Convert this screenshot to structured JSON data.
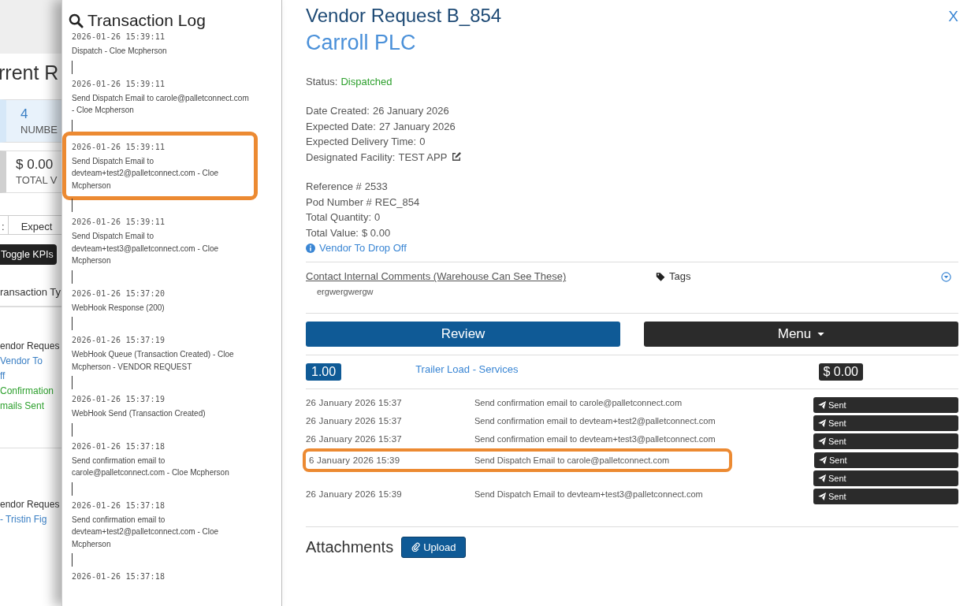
{
  "background_page": {
    "heading": "rrent R",
    "kpis": [
      {
        "value": "4",
        "label": "NUMBE"
      },
      {
        "value": "$ 0.00",
        "label": "TOTAL V"
      }
    ],
    "tab_labels": [
      ":",
      "Expect"
    ],
    "toggle_button": "Toggle KPIs",
    "column_header": "ransaction Ty",
    "rows": [
      {
        "lines": [
          {
            "text": "endor Reques",
            "kind": "plain"
          },
          {
            "text": "Vendor To",
            "kind": "link"
          },
          {
            "text": "ff",
            "kind": "link"
          },
          {
            "text": "Confirmation",
            "kind": "success"
          },
          {
            "text": "mails Sent",
            "kind": "success"
          }
        ]
      },
      {
        "lines": [
          {
            "text": "endor Reques",
            "kind": "plain"
          },
          {
            "text": "- Tristin Fig",
            "kind": "link"
          }
        ]
      }
    ]
  },
  "transaction_log": {
    "title": "Transaction Log",
    "entries": [
      {
        "time": "2026-01-26 15:39:11",
        "text": "Dispatch - Cloe Mcpherson",
        "highlighted": false
      },
      {
        "time": "2026-01-26 15:39:11",
        "text": "Send Dispatch Email to carole@palletconnect.com - Cloe Mcpherson",
        "highlighted": false
      },
      {
        "time": "2026-01-26 15:39:11",
        "text": "Send Dispatch Email to devteam+test2@palletconnect.com - Cloe Mcpherson",
        "highlighted": true
      },
      {
        "time": "2026-01-26 15:39:11",
        "text": "Send Dispatch Email to devteam+test3@palletconnect.com - Cloe Mcpherson",
        "highlighted": false
      },
      {
        "time": "2026-01-26 15:37:20",
        "text": "WebHook Response (200)",
        "highlighted": false
      },
      {
        "time": "2026-01-26 15:37:19",
        "text": "WebHook Queue (Transaction Created) - Cloe Mcpherson - VENDOR REQUEST",
        "highlighted": false
      },
      {
        "time": "2026-01-26 15:37:19",
        "text": "WebHook Send (Transaction Created)",
        "highlighted": false
      },
      {
        "time": "2026-01-26 15:37:18",
        "text": "Send confirmation email to carole@palletconnect.com - Cloe Mcpherson",
        "highlighted": false
      },
      {
        "time": "2026-01-26 15:37:18",
        "text": "Send confirmation email to devteam+test2@palletconnect.com - Cloe Mcpherson",
        "highlighted": false
      },
      {
        "time": "2026-01-26 15:37:18",
        "highlighted": false
      }
    ]
  },
  "detail": {
    "title": "Vendor Request B_854",
    "close": "X",
    "company": "Carroll PLC",
    "status_label": "Status:",
    "status": "Dispatched",
    "field_groups": [
      [
        {
          "label": "Date Created:",
          "value": "26 January 2026"
        },
        {
          "label": "Expected Date:",
          "value": "27 January 2026"
        },
        {
          "label": "Expected Delivery Time:",
          "value": "0"
        },
        {
          "label": "Designated Facility:",
          "value": "TEST APP",
          "editable": true
        }
      ],
      [
        {
          "label": "Reference #",
          "value": "2533"
        },
        {
          "label": "Pod Number #",
          "value": "REC_854"
        },
        {
          "label": "Total Quantity:",
          "value": "0"
        },
        {
          "label": "Total Value:",
          "value": "$ 0.00"
        }
      ]
    ],
    "info_link": "Vendor To Drop Off",
    "comments_link": "Contact Internal Comments (Warehouse Can See These)",
    "comment": "ergwergwergw",
    "tags_label": "Tags",
    "review_button": "Review",
    "menu_button": "Menu",
    "line_item": {
      "quantity": "1.00",
      "name": "Trailer Load - Services",
      "price": "$ 0.00"
    },
    "emails": [
      {
        "date": "26 January 2026 15:37",
        "description": "Send confirmation email to carole@palletconnect.com",
        "status": "Sent",
        "highlighted": false
      },
      {
        "date": "26 January 2026 15:37",
        "description": "Send confirmation email to devteam+test2@palletconnect.com",
        "status": "Sent",
        "highlighted": false
      },
      {
        "date": "26 January 2026 15:37",
        "description": "Send confirmation email to devteam+test3@palletconnect.com",
        "status": "Sent",
        "highlighted": false
      },
      {
        "date": "6 January 2026 15:39",
        "description": "Send Dispatch Email to carole@palletconnect.com",
        "status": "Sent",
        "highlighted": true
      },
      {
        "status": "Sent",
        "highlighted": false
      },
      {
        "date": "26 January 2026 15:39",
        "description": "Send Dispatch Email to devteam+test3@palletconnect.com",
        "status": "Sent",
        "highlighted": false
      }
    ],
    "attachments_title": "Attachments",
    "upload_button": "Upload"
  }
}
